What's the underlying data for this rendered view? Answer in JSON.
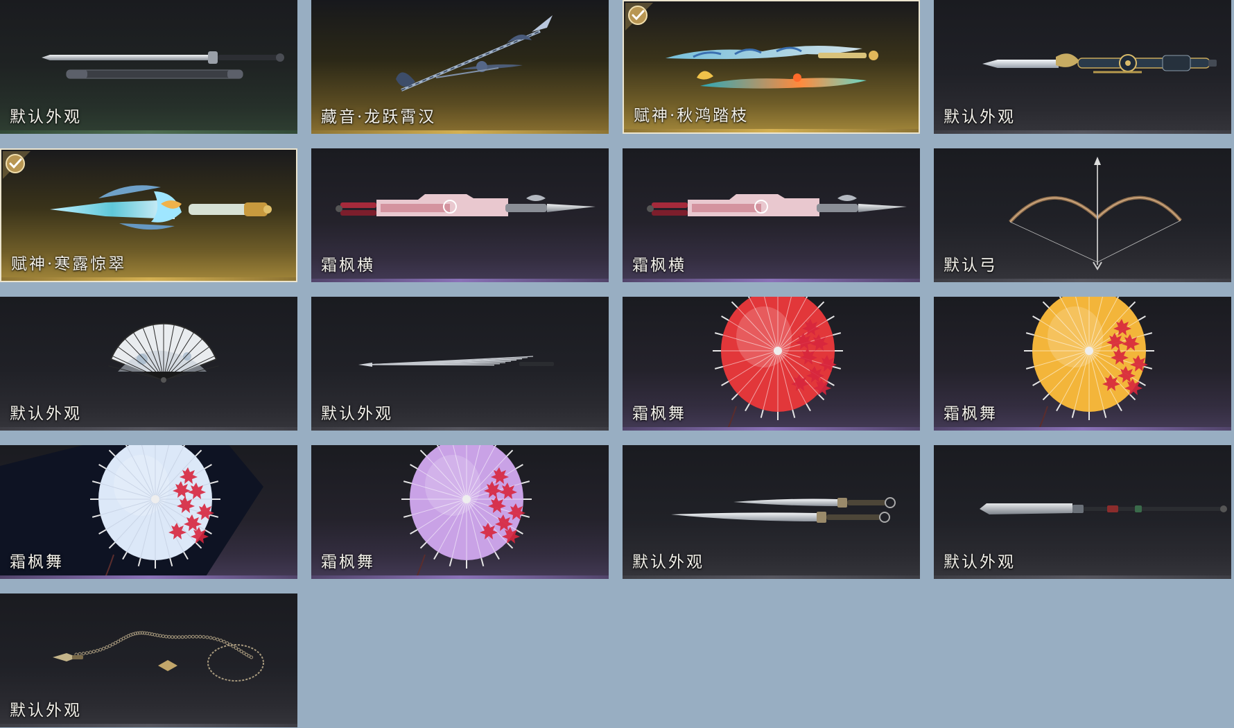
{
  "cards": [
    {
      "label": "默认外观",
      "art": "sword-icon",
      "theme": "green",
      "selected": false
    },
    {
      "label": "藏音·龙跃霄汉",
      "art": "spear-icon",
      "theme": "gold",
      "selected": false
    },
    {
      "label": "赋神·秋鸿踏枝",
      "art": "twin-blade-icon",
      "theme": "gold-bright",
      "selected": true
    },
    {
      "label": "默认外观",
      "art": "ornate-sword-icon",
      "theme": "dark",
      "selected": false
    },
    {
      "label": "赋神·寒露惊翠",
      "art": "jade-blade-icon",
      "theme": "gold-bright",
      "selected": true
    },
    {
      "label": "霜枫横",
      "art": "mech-blade-icon",
      "theme": "purple",
      "selected": false
    },
    {
      "label": "霜枫横",
      "art": "mech-blade-icon",
      "theme": "purple",
      "selected": false
    },
    {
      "label": "默认弓",
      "art": "bow-icon",
      "theme": "dark",
      "selected": false
    },
    {
      "label": "默认外观",
      "art": "fan-icon",
      "theme": "dark",
      "selected": false
    },
    {
      "label": "默认外观",
      "art": "darts-icon",
      "theme": "dark",
      "selected": false
    },
    {
      "label": "霜枫舞",
      "art": "umbrella-icon",
      "color": "#e2373a",
      "theme": "purple",
      "selected": false
    },
    {
      "label": "霜枫舞",
      "art": "umbrella-icon",
      "color": "#f3b53a",
      "theme": "purple",
      "selected": false
    },
    {
      "label": "霜枫舞",
      "art": "umbrella-icon",
      "color": "#dce8f8",
      "theme": "purple",
      "selected": false
    },
    {
      "label": "霜枫舞",
      "art": "umbrella-icon",
      "color": "#c9a2e6",
      "theme": "purple",
      "selected": false
    },
    {
      "label": "默认外观",
      "art": "dual-sabres-icon",
      "theme": "dark",
      "selected": false
    },
    {
      "label": "默认外观",
      "art": "long-glaive-icon",
      "theme": "dark",
      "selected": false
    },
    {
      "label": "默认外观",
      "art": "rope-dart-icon",
      "theme": "dark",
      "selected": false
    }
  ]
}
